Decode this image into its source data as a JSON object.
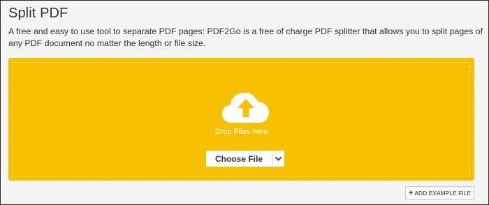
{
  "page": {
    "title": "Split PDF",
    "description": "A free and easy to use tool to separate PDF pages: PDF2Go is a free of charge PDF splitter that allows you to split pages of any PDF document no matter the length or file size."
  },
  "upload": {
    "drop_text": "Drop Files here",
    "choose_label": "Choose File",
    "icon": "cloud-upload-icon",
    "dropdown_icon": "chevron-down-icon"
  },
  "actions": {
    "add_example_label": "ADD EXAMPLE FILE",
    "add_example_icon": "plus-icon"
  },
  "colors": {
    "accent": "#f6c000",
    "text": "#333333",
    "background": "#f4f4f4"
  }
}
